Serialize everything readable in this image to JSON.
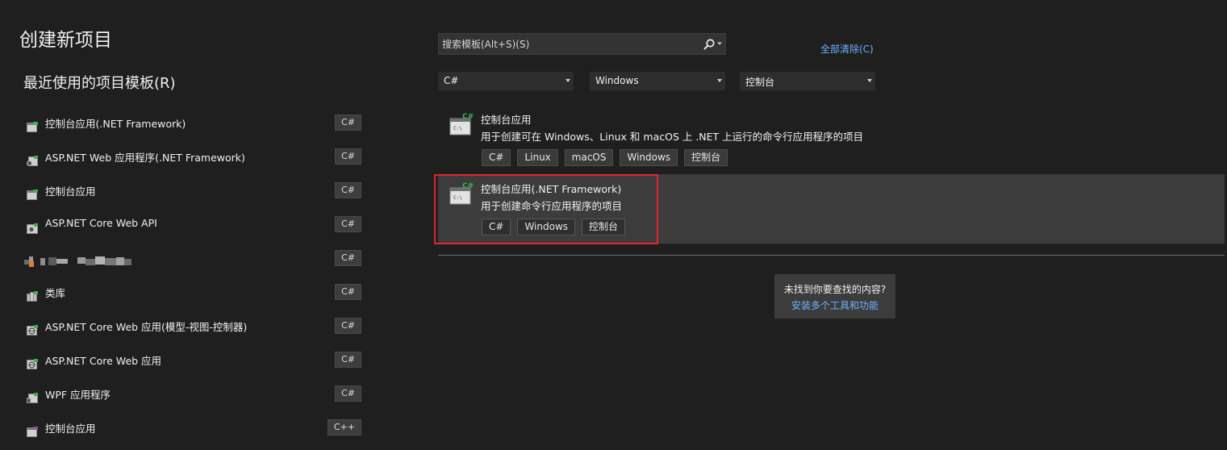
{
  "page": {
    "title": "创建新项目"
  },
  "recent": {
    "heading": "最近使用的项目模板(R)",
    "items": [
      {
        "label": "控制台应用(.NET Framework)",
        "lang": "C#",
        "icon": "console-app-icon"
      },
      {
        "label": "ASP.NET Web 应用程序(.NET Framework)",
        "lang": "C#",
        "icon": "web-app-icon"
      },
      {
        "label": "控制台应用",
        "lang": "C#",
        "icon": "console-app-icon"
      },
      {
        "label": "ASP.NET Core Web API",
        "lang": "C#",
        "icon": "web-api-icon"
      },
      {
        "label": "",
        "lang": "C#",
        "icon": "redacted-icon"
      },
      {
        "label": "类库",
        "lang": "C#",
        "icon": "class-library-icon"
      },
      {
        "label": "ASP.NET Core Web 应用(模型-视图-控制器)",
        "lang": "C#",
        "icon": "web-globe-icon"
      },
      {
        "label": "ASP.NET Core Web 应用",
        "lang": "C#",
        "icon": "web-globe-icon"
      },
      {
        "label": "WPF 应用程序",
        "lang": "C#",
        "icon": "wpf-app-icon"
      },
      {
        "label": "控制台应用",
        "lang": "C++",
        "icon": "console-app-icon"
      }
    ]
  },
  "search": {
    "placeholder": "搜索模板(Alt+S)(S)"
  },
  "clear_all": "全部清除(C)",
  "filters": {
    "language": "C#",
    "platform": "Windows",
    "project_type": "控制台"
  },
  "templates": [
    {
      "name": "控制台应用",
      "description": "用于创建可在 Windows、Linux 和 macOS 上 .NET 上运行的命令行应用程序的项目",
      "tags": [
        "C#",
        "Linux",
        "macOS",
        "Windows",
        "控制台"
      ],
      "icon_badge": "C#",
      "icon_text": "C:\\"
    },
    {
      "name": "控制台应用(.NET Framework)",
      "description": "用于创建命令行应用程序的项目",
      "tags": [
        "C#",
        "Windows",
        "控制台"
      ],
      "icon_badge": "C#",
      "icon_text": "C:\\"
    }
  ],
  "not_found": {
    "text": "未找到你要查找的内容?",
    "link": "安装多个工具和功能"
  },
  "colors": {
    "background": "#1f1f1f",
    "link": "#6eb4ff",
    "selected_row": "#3c3c3c",
    "highlight": "#e0262c",
    "csharp_green": "#3fae49"
  }
}
